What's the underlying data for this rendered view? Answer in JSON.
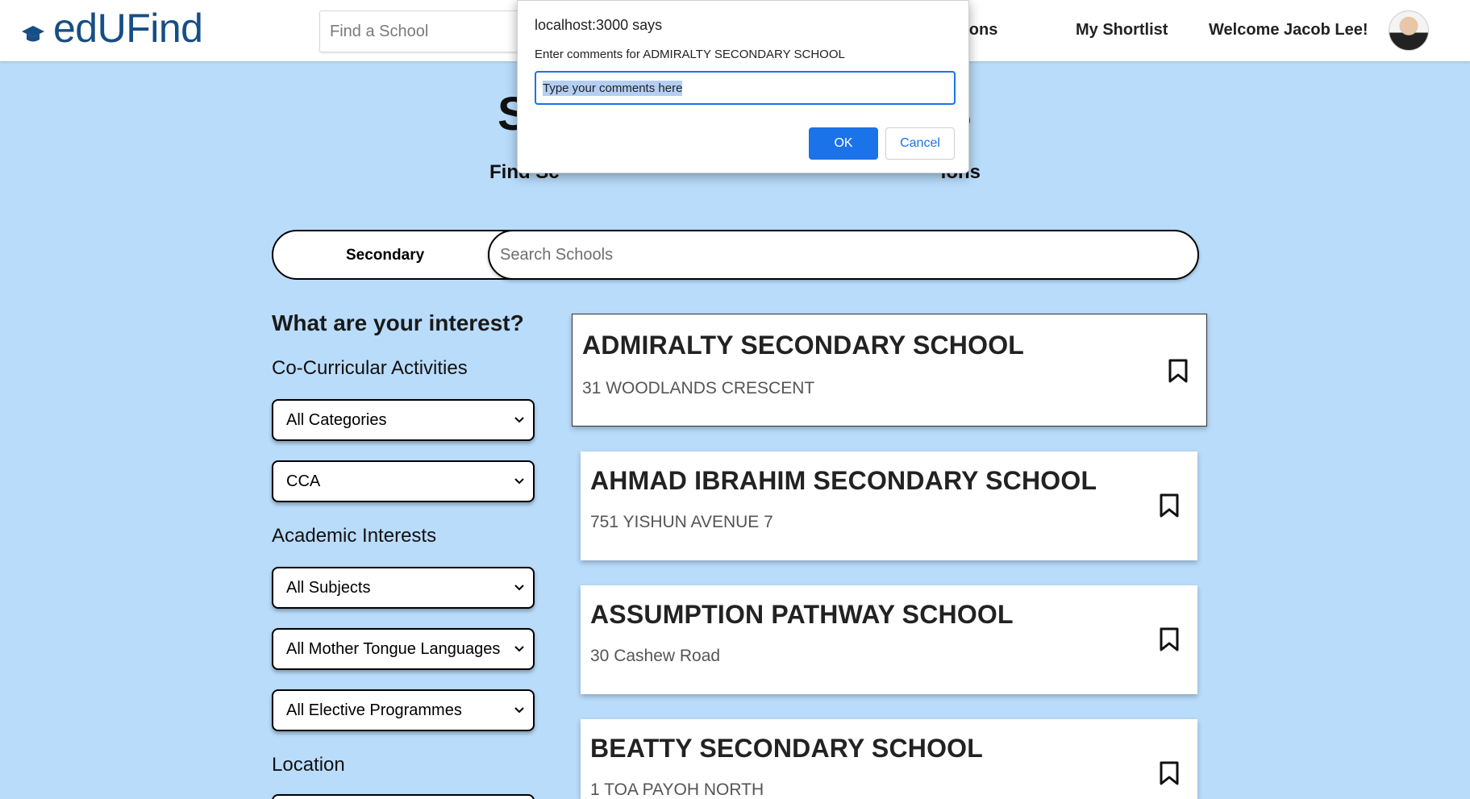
{
  "header": {
    "brand": "edUFind",
    "search_placeholder": "Find a School",
    "recommendations_label": "ndations",
    "shortlist_label": "My Shortlist",
    "welcome_text": "Welcome Jacob Lee!"
  },
  "hero": {
    "title_left": "SE",
    "title_right": "S",
    "subtitle_left": "Find Sc",
    "subtitle_right": "ions"
  },
  "search": {
    "level": "Secondary",
    "placeholder": "Search Schools"
  },
  "sidebar": {
    "heading": "What are your interest?",
    "cca_label": "Co-Curricular Activities",
    "cca_category": "All Categories",
    "cca_value": "CCA",
    "academic_label": "Academic Interests",
    "subjects": "All Subjects",
    "mother_tongue": "All Mother Tongue Languages",
    "elective": "All Elective Programmes",
    "location_label": "Location"
  },
  "schools": [
    {
      "name": "ADMIRALTY SECONDARY SCHOOL",
      "address": "31 WOODLANDS CRESCENT"
    },
    {
      "name": "AHMAD IBRAHIM SECONDARY SCHOOL",
      "address": "751 YISHUN AVENUE 7"
    },
    {
      "name": "ASSUMPTION PATHWAY SCHOOL",
      "address": "30 Cashew Road"
    },
    {
      "name": "BEATTY SECONDARY SCHOOL",
      "address": "1 TOA PAYOH NORTH"
    }
  ],
  "dialog": {
    "origin": "localhost:3000 says",
    "message": "Enter comments for ADMIRALTY SECONDARY SCHOOL",
    "input_value": "Type your comments here",
    "ok_label": "OK",
    "cancel_label": "Cancel"
  },
  "colors": {
    "page_background": "#b9dcfb",
    "brand": "#164e85",
    "dialog_accent": "#1a73e8"
  },
  "icons": [
    "graduation-cap-icon",
    "chevron-down-icon",
    "bookmark-icon",
    "user-avatar"
  ]
}
